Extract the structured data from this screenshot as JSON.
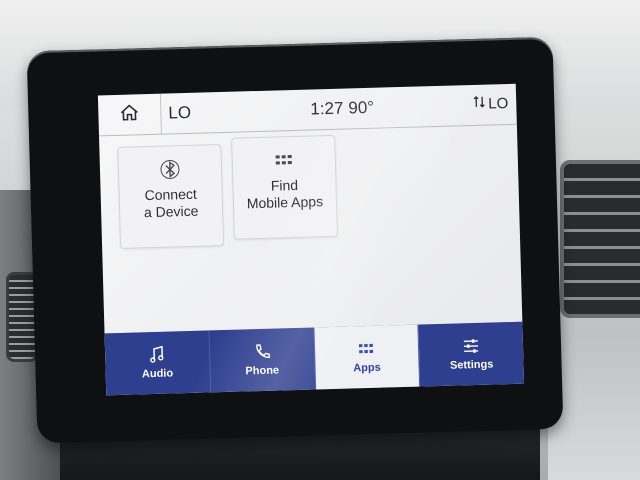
{
  "status_bar": {
    "climate_left": "LO",
    "time": "1:27",
    "temperature": "90°",
    "climate_right": "LO"
  },
  "tiles": [
    {
      "label_line1": "Connect",
      "label_line2": "a Device",
      "icon": "bluetooth-icon"
    },
    {
      "label_line1": "Find",
      "label_line2": "Mobile Apps",
      "icon": "apps-grid-icon"
    }
  ],
  "nav": [
    {
      "label": "Audio",
      "icon": "music-note-icon",
      "active": false
    },
    {
      "label": "Phone",
      "icon": "phone-icon",
      "active": false
    },
    {
      "label": "Apps",
      "icon": "apps-grid-icon",
      "active": true
    },
    {
      "label": "Settings",
      "icon": "sliders-icon",
      "active": false
    }
  ],
  "colors": {
    "nav_background": "#2f3f8f",
    "active_tab": "#eef0f4",
    "accent": "#3a49b8"
  }
}
